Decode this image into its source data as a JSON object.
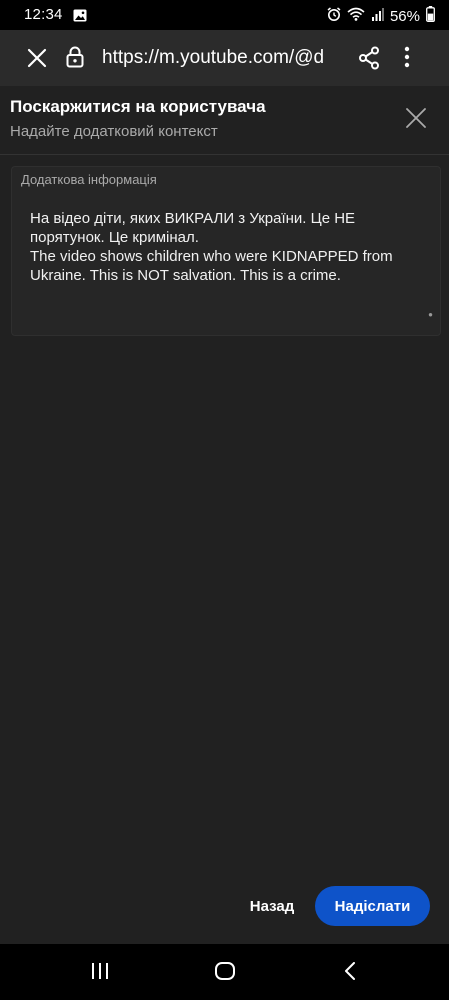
{
  "status_bar": {
    "time": "12:34",
    "battery": "56%",
    "icons": [
      "gallery-icon",
      "alarm-icon",
      "wifi-icon",
      "signal-icon",
      "battery-icon"
    ]
  },
  "browser": {
    "url": "https://m.youtube.com/@d",
    "icons": [
      "close-icon",
      "lock-icon",
      "share-icon",
      "more-vert-icon"
    ]
  },
  "dialog": {
    "title": "Поскаржитися на користувача",
    "subtitle": "Надайте додатковий контекст",
    "field": {
      "label": "Додаткова інформація",
      "value": "На відео діти, яких ВИКРАЛИ з України. Це НЕ порятунок. Це кримінал.\nThe video shows children who were KIDNAPPED from Ukraine.  This is NOT salvation.  This is a crime."
    },
    "back_label": "Назад",
    "submit_label": "Надіслати"
  },
  "colors": {
    "background": "#212121",
    "accent": "#0e53c9",
    "secondary_text": "#aaaaaa"
  }
}
